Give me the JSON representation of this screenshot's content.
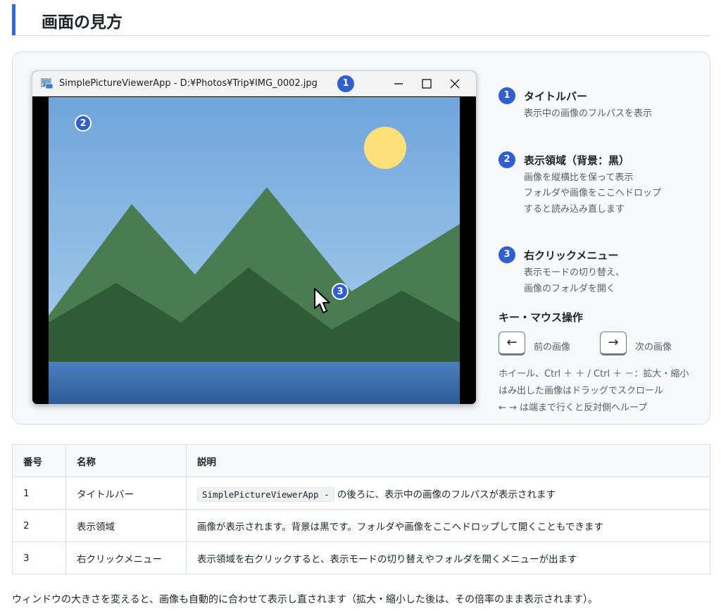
{
  "heading": "画面の見方",
  "window": {
    "title": "SimplePictureViewerApp - D:¥Photos¥Trip¥IMG_0002.jpg"
  },
  "badges": [
    "1",
    "2",
    "3"
  ],
  "legend": {
    "items": [
      {
        "num": "1",
        "title": "タイトルバー",
        "desc": [
          "表示中の画像のフルパスを表示"
        ]
      },
      {
        "num": "2",
        "title": "表示領域（背景：黒）",
        "desc": [
          "画像を縦横比を保って表示",
          "フォルダや画像をここへドロップ",
          "すると読み込み直します"
        ]
      },
      {
        "num": "3",
        "title": "右クリックメニュー",
        "desc": [
          "表示モードの切り替え、",
          "画像のフォルダを開く"
        ]
      }
    ],
    "keys_title": "キー・マウス操作",
    "keys": [
      {
        "glyph": "←",
        "label": "前の画像"
      },
      {
        "glyph": "→",
        "label": "次の画像"
      }
    ],
    "notes": [
      "ホイール、Ctrl ＋ ＋ / Ctrl ＋ －：拡大・縮小",
      "はみ出した画像はドラッグでスクロール",
      "← → は端まで行くと反対側へループ"
    ]
  },
  "table": {
    "headers": [
      "番号",
      "名称",
      "説明"
    ],
    "rows": [
      {
        "num": "1",
        "name": "タイトルバー",
        "code": "SimplePictureViewerApp -",
        "desc": "の後ろに、表示中の画像のフルパスが表示されます"
      },
      {
        "num": "2",
        "name": "表示領域",
        "code": "",
        "desc": "画像が表示されます。背景は黒です。フォルダや画像をここへドロップして開くこともできます"
      },
      {
        "num": "3",
        "name": "右クリックメニュー",
        "code": "",
        "desc": "表示領域を右クリックすると、表示モードの切り替えやフォルダを開くメニューが出ます"
      }
    ]
  },
  "footer": "ウィンドウの大きさを変えると、画像も自動的に合わせて表示し直されます（拡大・縮小した後は、その倍率のまま表示されます）。",
  "colors": {
    "accent": "#2f6bd8",
    "badge": "#2f5fd0"
  }
}
